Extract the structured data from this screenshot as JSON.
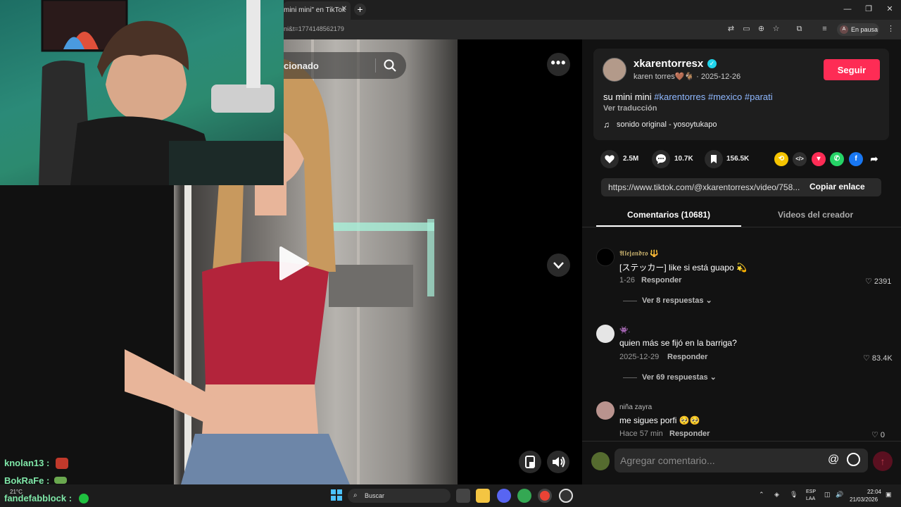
{
  "browser": {
    "tab_title": "mini mini\" en TikTok",
    "url": "ni&t=1774148562179",
    "profile_status": "En pausa",
    "profile_initial": "A"
  },
  "video": {
    "search_placeholder": "cionado",
    "more_label": "•••"
  },
  "chat": [
    {
      "user": "knolan13 :",
      "emote_color": "#c0392b"
    },
    {
      "user": "BokRaFe :",
      "emote_color": "#6aa84f"
    },
    {
      "user": "fandefabblock :",
      "emote_color": "#1fbf3f"
    }
  ],
  "post": {
    "username": "xkarentorresx",
    "display_name": "karen torres🤎🐐",
    "date": "· 2025-12-26",
    "follow_label": "Seguir",
    "caption_text": "su mini mini",
    "hashtags": [
      "#karentorres",
      "#mexico",
      "#parati"
    ],
    "translate_label": "Ver traducción",
    "music": "sonido original - yosoytukapo",
    "likes": "2.5M",
    "comments": "10.7K",
    "saves": "156.5K",
    "share_link": "https://www.tiktok.com/@xkarentorresx/video/758...",
    "copy_link_label": "Copiar enlace"
  },
  "tabs": {
    "comments": "Comentarios (10681)",
    "creator_videos": "Videos del creador"
  },
  "comments": [
    {
      "user": "𝕬𝖑𝖊𝖏𝖆𝖓𝖉𝖗𝖔 🔱",
      "text": "[ステッカー] like si está guapo 💫",
      "date": "1-26",
      "reply_label": "Responder",
      "likes": "2391",
      "more_replies": "Ver 8 respuestas"
    },
    {
      "user": "👾.",
      "text": "quien más se fijó en la barriga?",
      "date": "2025-12-29",
      "reply_label": "Responder",
      "likes": "83.4K",
      "more_replies": "Ver 69 respuestas"
    },
    {
      "user": "niña zayra",
      "text": "me sigues porfi 🥺🥺",
      "date": "Hace 57 min",
      "reply_label": "Responder",
      "likes": "0"
    }
  ],
  "composer": {
    "placeholder": "Agregar comentario...",
    "at_label": "@"
  },
  "taskbar": {
    "search_label": "Buscar",
    "weather": "21°C",
    "lang1": "ESP",
    "lang2": "LAA",
    "time": "22:04",
    "date": "21/03/2026"
  },
  "colors": {
    "follow": "#fe2c55",
    "hashtag": "#8fb8ff",
    "verified": "#20d5ec"
  }
}
